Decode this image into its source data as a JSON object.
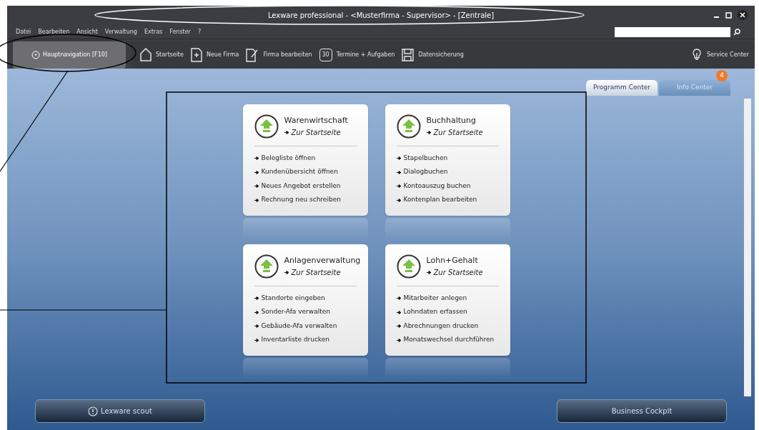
{
  "window": {
    "title": "Lexware professional - <Musterfirma - Supervisor> - [Zentrale]"
  },
  "menu": [
    "Datei",
    "Bearbeiten",
    "Ansicht",
    "Verwaltung",
    "Extras",
    "Fenster",
    "?"
  ],
  "main_nav": {
    "label": "Hauptnavigation [F10]"
  },
  "toolbar": [
    {
      "kind": "home",
      "label": "Startseite"
    },
    {
      "kind": "new",
      "label": "Neue Firma"
    },
    {
      "kind": "edit",
      "label": "Firma bearbeiten"
    },
    {
      "kind": "calendar",
      "label": "Termine + Aufgaben",
      "icon_text": "30"
    },
    {
      "kind": "save",
      "label": "Datensicherung"
    }
  ],
  "service": {
    "label": "Service Center"
  },
  "tabs": [
    {
      "label": "Programm Center",
      "selected": true
    },
    {
      "label": "Info Center",
      "selected": false,
      "badge": "4"
    }
  ],
  "modules": [
    {
      "title": "Warenwirtschaft",
      "home_link": "Zur Startseite",
      "actions": [
        "Belegliste öffnen",
        "Kundenübersicht öffnen",
        "Neues Angebot erstellen",
        "Rechnung neu schreiben"
      ]
    },
    {
      "title": "Buchhaltung",
      "home_link": "Zur Startseite",
      "actions": [
        "Stapelbuchen",
        "Dialogbuchen",
        "Kontoauszug buchen",
        "Kontenplan bearbeiten"
      ]
    },
    {
      "title": "Anlagenverwaltung",
      "home_link": "Zur Startseite",
      "actions": [
        "Standorte eingeben",
        "Sonder-Afa verwalten",
        "Gebäude-Afa verwalten",
        "Inventarliste drucken"
      ]
    },
    {
      "title": "Lohn+Gehalt",
      "home_link": "Zur Startseite",
      "actions": [
        "Mitarbeiter anlegen",
        "Lohndaten erfassen",
        "Abrechnungen drucken",
        "Monatswechsel durchführen"
      ]
    }
  ],
  "bottom_buttons": [
    {
      "kind": "info",
      "label": "Lexware scout"
    },
    {
      "kind": "plain",
      "label": "Business Cockpit"
    }
  ]
}
